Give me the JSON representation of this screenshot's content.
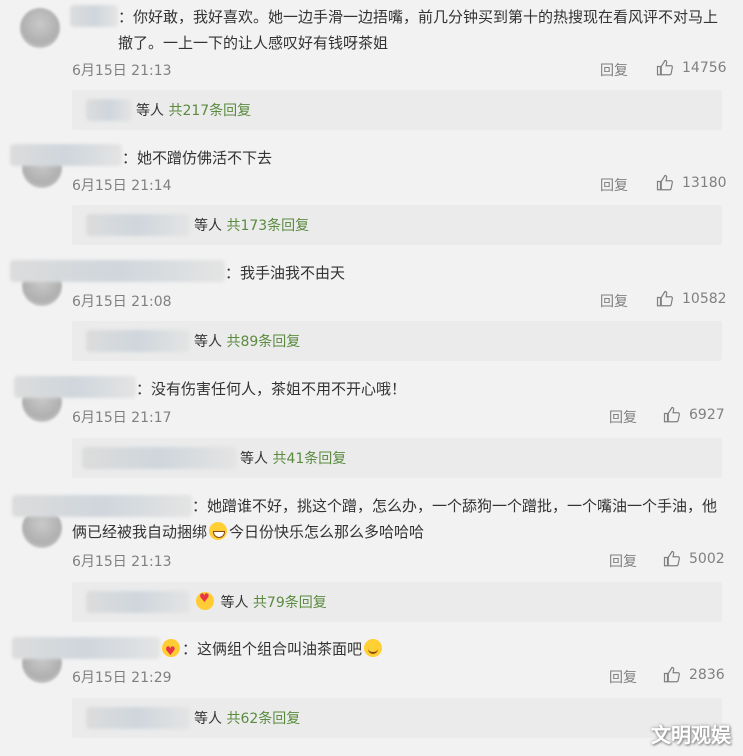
{
  "comments": [
    {
      "text": "：你好敢，我好喜欢。她一边手滑一边捂嘴，前几分钟买到第十的热搜现在看风评不对马上撤了。一上一下的让人感叹好有钱呀茶姐",
      "date": "6月15日 21:13",
      "reply_label": "回复",
      "likes": "14756",
      "reply_summary_prefix": "等人",
      "reply_count": "共217条回复"
    },
    {
      "text": "：她不蹭仿佛活不下去",
      "date": "6月15日 21:14",
      "reply_label": "回复",
      "likes": "13180",
      "reply_summary_prefix": "等人",
      "reply_count": "共173条回复"
    },
    {
      "text": "：我手油我不由天",
      "date": "6月15日 21:08",
      "reply_label": "回复",
      "likes": "10582",
      "reply_summary_prefix": "等人",
      "reply_count": "共89条回复"
    },
    {
      "text": "：没有伤害任何人，茶姐不用不开心哦！",
      "date": "6月15日 21:17",
      "reply_label": "回复",
      "likes": "6927",
      "reply_summary_prefix": "等人",
      "reply_count": "共41条回复"
    },
    {
      "text_a": "：她蹭谁不好，挑这个蹭，怎么办，一个舔狗一个蹭批，一个嘴油一个手油，他俩已经被我自动捆绑",
      "text_b": "今日份快乐怎么那么多哈哈哈",
      "date": "6月15日 21:13",
      "reply_label": "回复",
      "likes": "5002",
      "reply_summary_prefix": "等人",
      "reply_count": "共79条回复"
    },
    {
      "text": "：这俩组个组合叫油茶面吧",
      "date": "6月15日 21:29",
      "reply_label": "回复",
      "likes": "2836",
      "reply_summary_prefix": "等人",
      "reply_count": "共62条回复"
    }
  ],
  "icons": {
    "like": "thumbs-up-icon",
    "emoji_laugh": "laughing-emoji-icon",
    "emoji_heart": "heart-eyes-emoji-icon",
    "emoji_grin": "grin-emoji-icon"
  },
  "watermark": "文明观娱",
  "colors": {
    "link": "#5a8b3f",
    "meta": "#808080",
    "reply_bg": "#ebebeb"
  }
}
